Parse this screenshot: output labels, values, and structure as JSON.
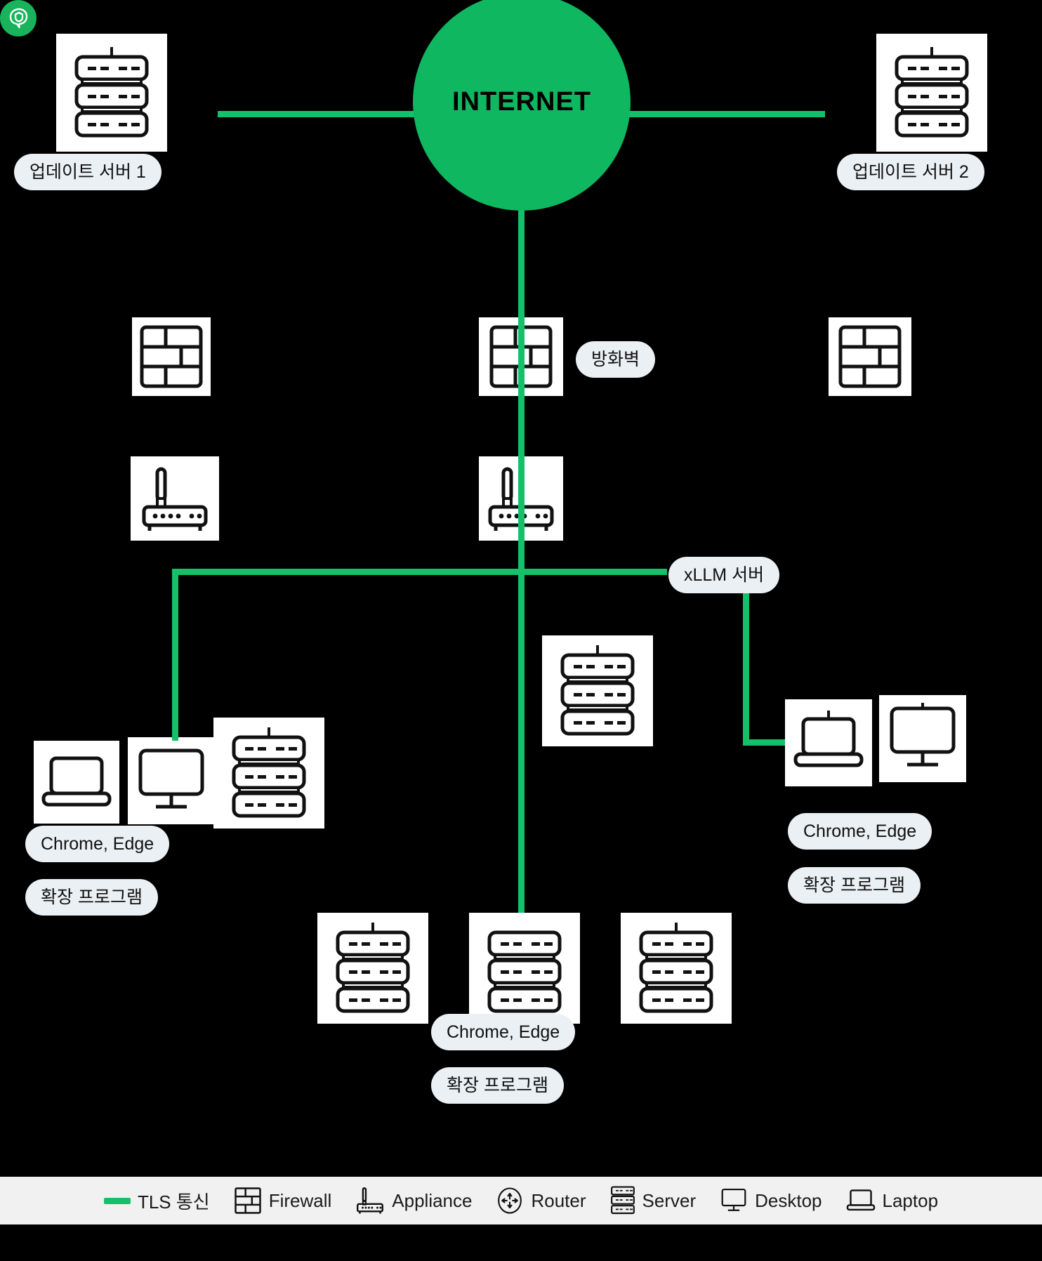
{
  "diagram": {
    "title": "xLLM network topology",
    "background_color": "#000000",
    "accent_color": "#16C06A",
    "internet": {
      "label": "INTERNET",
      "fill": "#0FB761",
      "text_color": "#000000"
    },
    "nodes": [
      {
        "id": "update-server-1",
        "label": "업데이트 서버 1",
        "icon": "server-icon"
      },
      {
        "id": "update-server-2",
        "label": "업데이트 서버 2",
        "icon": "server-icon"
      },
      {
        "id": "firewall-center",
        "label": "방화벽",
        "icon": "firewall-icon"
      },
      {
        "id": "firewall-left",
        "label": "",
        "icon": "firewall-icon"
      },
      {
        "id": "firewall-right",
        "label": "",
        "icon": "firewall-icon"
      },
      {
        "id": "appliance-left",
        "label": "",
        "icon": "appliance-icon"
      },
      {
        "id": "appliance-center",
        "label": "",
        "icon": "appliance-icon"
      },
      {
        "id": "xllm-server",
        "label": "xLLM 서버",
        "icon": "xllm-logo-icon",
        "badge_color": "#18B35A"
      }
    ],
    "endpoint_groups": [
      {
        "id": "left-cluster",
        "icons": [
          "laptop-icon",
          "desktop-icon",
          "server-icon"
        ],
        "labels": [
          "Chrome, Edge",
          "확장 프로그램"
        ]
      },
      {
        "id": "center-cluster",
        "icons": [
          "server-icon",
          "server-icon",
          "server-icon"
        ],
        "labels": [
          "Chrome, Edge",
          "확장 프로그램"
        ]
      },
      {
        "id": "right-cluster",
        "icons": [
          "laptop-icon",
          "desktop-icon"
        ],
        "labels": [
          "Chrome, Edge",
          "확장 프로그램"
        ]
      }
    ]
  },
  "legend": {
    "items": [
      {
        "icon": "tls-line-swatch",
        "label": "TLS 통신"
      },
      {
        "icon": "firewall-icon",
        "label": "Firewall"
      },
      {
        "icon": "appliance-icon",
        "label": "Appliance"
      },
      {
        "icon": "router-icon",
        "label": "Router"
      },
      {
        "icon": "server-icon",
        "label": "Server"
      },
      {
        "icon": "desktop-icon",
        "label": "Desktop"
      },
      {
        "icon": "laptop-icon",
        "label": "Laptop"
      }
    ]
  }
}
